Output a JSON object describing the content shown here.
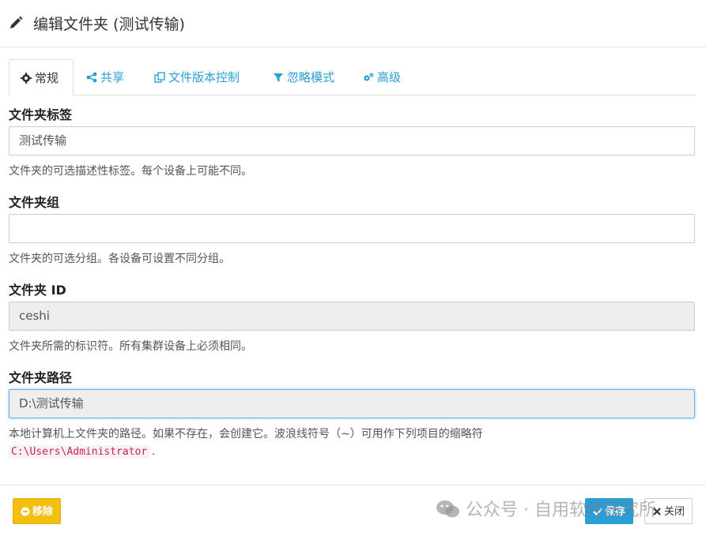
{
  "dialog": {
    "title": "编辑文件夹 (测试传输)"
  },
  "tabs": [
    {
      "label": "常规",
      "icon": "gear-icon"
    },
    {
      "label": "共享",
      "icon": "share-icon"
    },
    {
      "label": "文件版本控制",
      "icon": "copy-icon"
    },
    {
      "label": "忽略模式",
      "icon": "filter-icon"
    },
    {
      "label": "高级",
      "icon": "cogs-icon"
    }
  ],
  "form": {
    "label_field": {
      "label": "文件夹标签",
      "value": "测试传输",
      "help": "文件夹的可选描述性标签。每个设备上可能不同。"
    },
    "group_field": {
      "label": "文件夹组",
      "value": "",
      "help": "文件夹的可选分组。各设备可设置不同分组。"
    },
    "id_field": {
      "label": "文件夹 ID",
      "value": "ceshi",
      "help": "文件夹所需的标识符。所有集群设备上必须相同。"
    },
    "path_field": {
      "label": "文件夹路径",
      "value": "D:\\测试传输",
      "help": "本地计算机上文件夹的路径。如果不存在，会创建它。波浪线符号（~）可用作下列项目的缩略符",
      "help_code": "C:\\Users\\Administrator",
      "help_code_suffix": "."
    }
  },
  "footer": {
    "remove_label": "移除",
    "save_label": "保存",
    "close_label": "关闭"
  },
  "watermark": {
    "text": "公众号 · 自用软件研究所"
  },
  "colors": {
    "accent": "#2a9fd6",
    "warning": "#f3c012",
    "code": "#c7254e"
  }
}
